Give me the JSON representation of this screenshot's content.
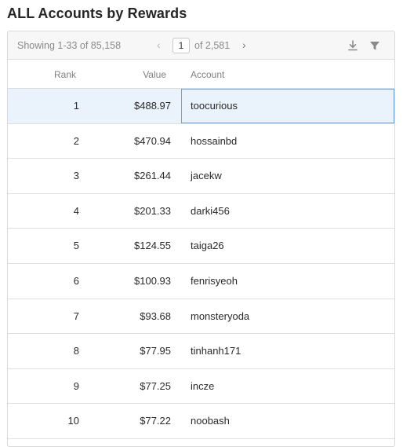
{
  "title": "ALL Accounts by Rewards",
  "pagination": {
    "showing": "Showing 1-33 of 85,158",
    "prev": "‹",
    "page": "1",
    "of_pages": "of 2,581",
    "next": "›"
  },
  "icons": {
    "download": "download-icon",
    "filter": "filter-icon"
  },
  "columns": {
    "rank": "Rank",
    "value": "Value",
    "account": "Account"
  },
  "rows": [
    {
      "rank": "1",
      "value": "$488.97",
      "account": "toocurious",
      "selected": true
    },
    {
      "rank": "2",
      "value": "$470.94",
      "account": "hossainbd"
    },
    {
      "rank": "3",
      "value": "$261.44",
      "account": "jacekw"
    },
    {
      "rank": "4",
      "value": "$201.33",
      "account": "darki456"
    },
    {
      "rank": "5",
      "value": "$124.55",
      "account": "taiga26"
    },
    {
      "rank": "6",
      "value": "$100.93",
      "account": "fenrisyeoh"
    },
    {
      "rank": "7",
      "value": "$93.68",
      "account": "monsteryoda"
    },
    {
      "rank": "8",
      "value": "$77.95",
      "account": "tinhanh171"
    },
    {
      "rank": "9",
      "value": "$77.25",
      "account": "incze"
    },
    {
      "rank": "10",
      "value": "$77.22",
      "account": "noobash"
    }
  ],
  "colors": {
    "selected_row_bg": "#eaf3fc",
    "selected_cell_border": "#6aa6dc",
    "toolbar_bg": "#f7f7f7"
  }
}
